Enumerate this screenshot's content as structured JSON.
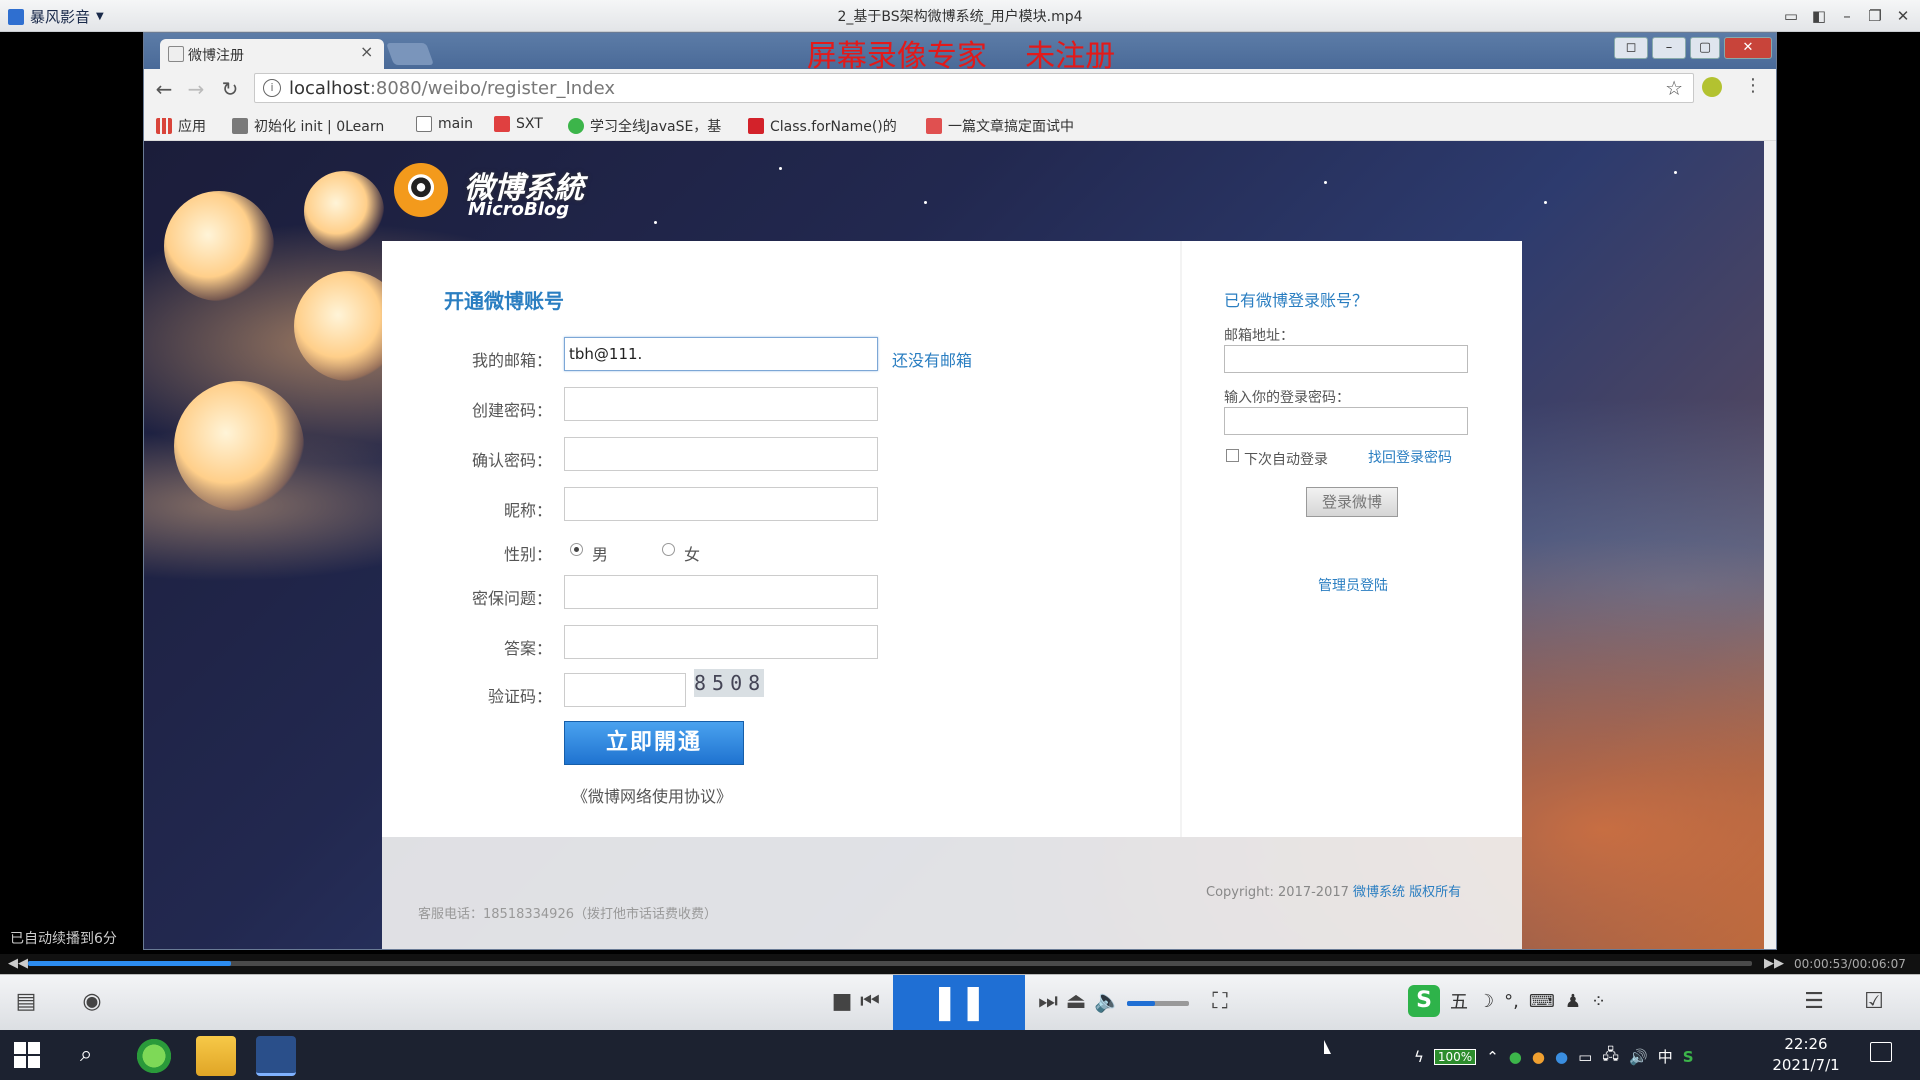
{
  "player": {
    "app_name": "暴风影音",
    "file_name": "2_基于BS架构微博系统_用户模块.mp4",
    "resume_hint": "已自动续播到6分",
    "time": "00:00:53/00:06:07",
    "progress_fraction": 0.118,
    "volume_fraction": 0.45
  },
  "browser": {
    "tab_title": "微博注册",
    "url_host": "localhost",
    "url_rest": ":8080/weibo/register_Index",
    "watermark": "屏幕录像专家    未注册",
    "bookmarks": [
      {
        "label": "应用",
        "icon_color": "#d9443a"
      },
      {
        "label": "初始化 init | 0Learn",
        "icon_color": "#7a7a7a"
      },
      {
        "label": "main",
        "icon_color": "#ffffff"
      },
      {
        "label": "SXT",
        "icon_color": "#e04040"
      },
      {
        "label": "学习全线JavaSE，基",
        "icon_color": "#3cb54a"
      },
      {
        "label": "Class.forName()的",
        "icon_color": "#d3222a"
      },
      {
        "label": "一篇文章搞定面试中",
        "icon_color": "#e05050"
      }
    ]
  },
  "logo": {
    "cn": "微博系統",
    "en": "MicroBlog"
  },
  "register": {
    "heading": "开通微博账号",
    "email_label": "我的邮箱：",
    "email_value": "tbh@111.",
    "no_email_link": "还没有邮箱",
    "password_label": "创建密码：",
    "confirm_label": "确认密码：",
    "nickname_label": "昵称：",
    "gender_label": "性别：",
    "gender_male": "男",
    "gender_female": "女",
    "question_label": "密保问题：",
    "answer_label": "答案：",
    "captcha_label": "验证码：",
    "captcha_code": "8508",
    "submit_label": "立即開通",
    "terms_link": "《微博网络使用协议》"
  },
  "login": {
    "heading": "已有微博登录账号？",
    "email_label": "邮箱地址：",
    "password_label": "输入你的登录密码：",
    "remember_label": "下次自动登录",
    "forgot_link": "找回登录密码",
    "login_button": "登录微博",
    "admin_link": "管理员登陆"
  },
  "footer": {
    "phone": "客服电话：18518334926（拨打他市话话费收费）",
    "copyright": "Copyright: 2017-2017",
    "brand": "微博系统 版权所有"
  },
  "taskbar": {
    "time": "22:26",
    "date": "2021/7/1",
    "battery": "100%",
    "ime_lang": "中"
  }
}
